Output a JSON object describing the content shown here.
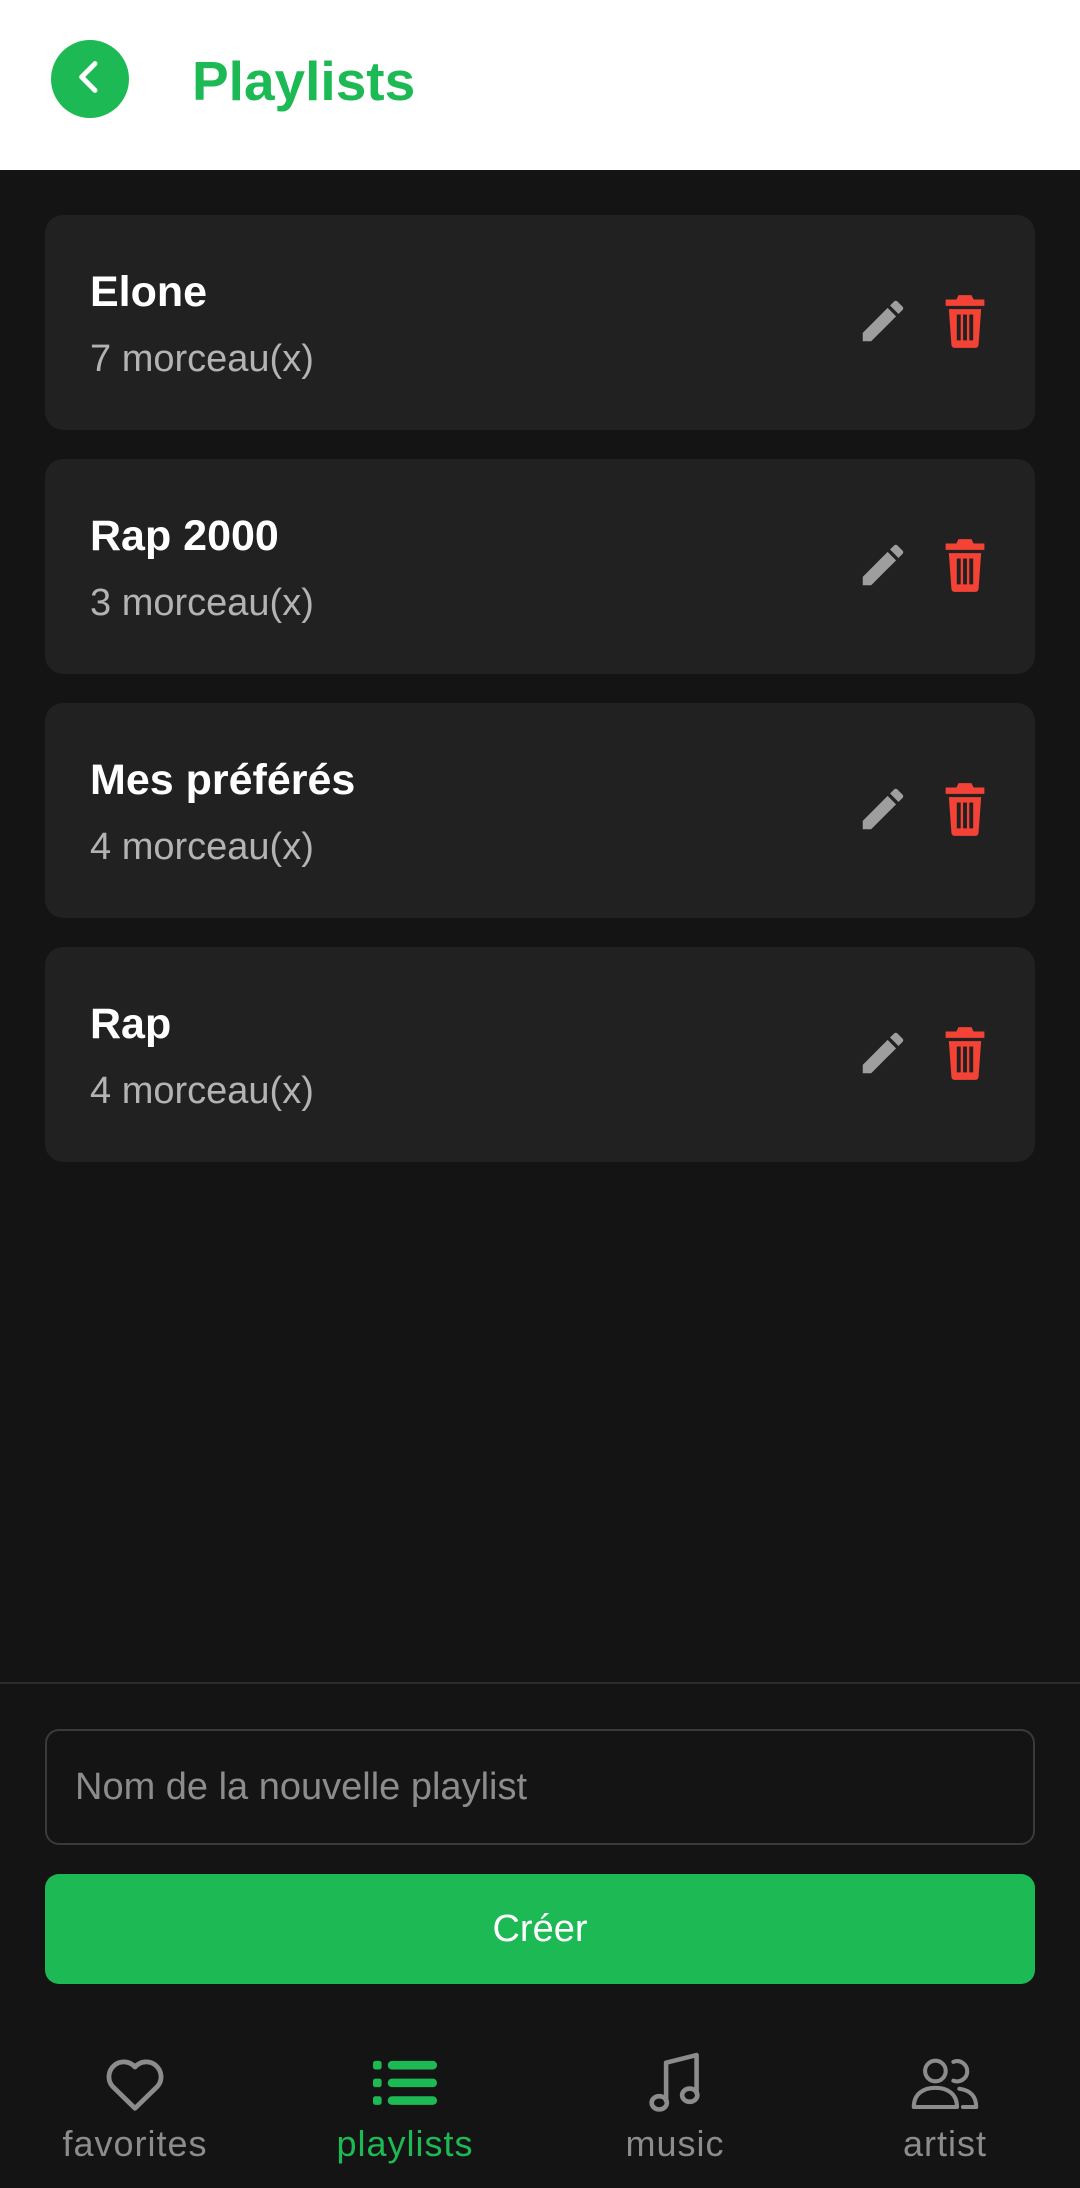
{
  "header": {
    "title": "Playlists",
    "back_icon": "chevron-left-icon"
  },
  "playlists": [
    {
      "name": "Elone",
      "count": "7 morceau(x)"
    },
    {
      "name": "Rap 2000",
      "count": "3 morceau(x)"
    },
    {
      "name": "Mes préférés",
      "count": "4 morceau(x)"
    },
    {
      "name": "Rap",
      "count": "4 morceau(x)"
    }
  ],
  "create": {
    "input_placeholder": "Nom de la nouvelle playlist",
    "input_value": "",
    "button_label": "Créer"
  },
  "nav": {
    "items": [
      {
        "label": "favorites",
        "icon": "heart-icon",
        "active": false
      },
      {
        "label": "playlists",
        "icon": "list-icon",
        "active": true
      },
      {
        "label": "music",
        "icon": "music-note-icon",
        "active": false
      },
      {
        "label": "artist",
        "icon": "users-icon",
        "active": false
      }
    ]
  },
  "colors": {
    "accent": "#1DB954",
    "background": "#141414",
    "card": "#212121",
    "delete": "#F44336",
    "edit": "#9E9E9E",
    "muted_text": "#B3B3B3"
  }
}
